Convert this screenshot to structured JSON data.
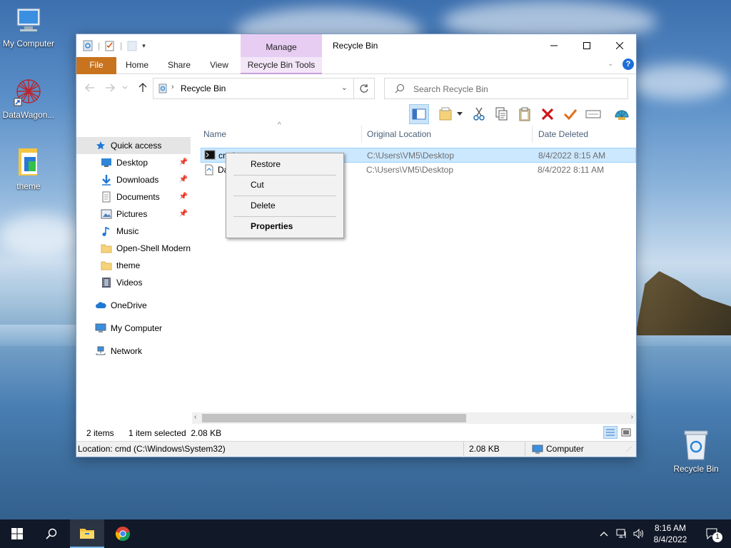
{
  "desktop": {
    "icons": [
      {
        "label": "My Computer"
      },
      {
        "label": "DataWagon..."
      },
      {
        "label": "theme"
      },
      {
        "label": "Recycle Bin"
      }
    ]
  },
  "window": {
    "title": "Recycle Bin",
    "contextual_group": "Manage",
    "ribbon_tabs": {
      "file": "File",
      "home": "Home",
      "share": "Share",
      "view": "View",
      "contextual": "Recycle Bin Tools"
    },
    "help_label": "?",
    "address": {
      "path": "Recycle Bin"
    },
    "search": {
      "placeholder": "Search Recycle Bin"
    },
    "nav": {
      "quick_access": "Quick access",
      "items": [
        {
          "label": "Desktop",
          "pinned": true
        },
        {
          "label": "Downloads",
          "pinned": true
        },
        {
          "label": "Documents",
          "pinned": true
        },
        {
          "label": "Pictures",
          "pinned": true
        },
        {
          "label": "Music",
          "pinned": false
        },
        {
          "label": "Open-Shell Modern",
          "pinned": false
        },
        {
          "label": "theme",
          "pinned": false
        },
        {
          "label": "Videos",
          "pinned": false
        }
      ],
      "onedrive": "OneDrive",
      "my_computer": "My Computer",
      "network": "Network"
    },
    "columns": {
      "name": "Name",
      "original_location": "Original Location",
      "date_deleted": "Date Deleted"
    },
    "rows": [
      {
        "name": "cmd",
        "location": "C:\\Users\\VM5\\Desktop",
        "date": "8/4/2022 8:15 AM",
        "selected": true
      },
      {
        "name": "Da",
        "location": "C:\\Users\\VM5\\Desktop",
        "date": "8/4/2022 8:11 AM",
        "selected": false
      }
    ],
    "status": {
      "count": "2 items",
      "selection": "1 item selected  2.08 KB"
    },
    "details": {
      "location": "Location: cmd (C:\\Windows\\System32)",
      "size": "2.08 KB",
      "zone": "Computer"
    }
  },
  "context_menu": {
    "items": [
      {
        "label": "Restore",
        "bold": false
      },
      {
        "label": "Cut",
        "bold": false
      },
      {
        "label": "Delete",
        "bold": false
      },
      {
        "label": "Properties",
        "bold": true
      }
    ]
  },
  "taskbar": {
    "time": "8:16 AM",
    "date": "8/4/2022",
    "notification_count": "1"
  },
  "colors": {
    "file_tab": "#c8731e",
    "manage_tab": "#e8cdf2",
    "selection": "#cce8ff",
    "taskbar": "#111827"
  }
}
